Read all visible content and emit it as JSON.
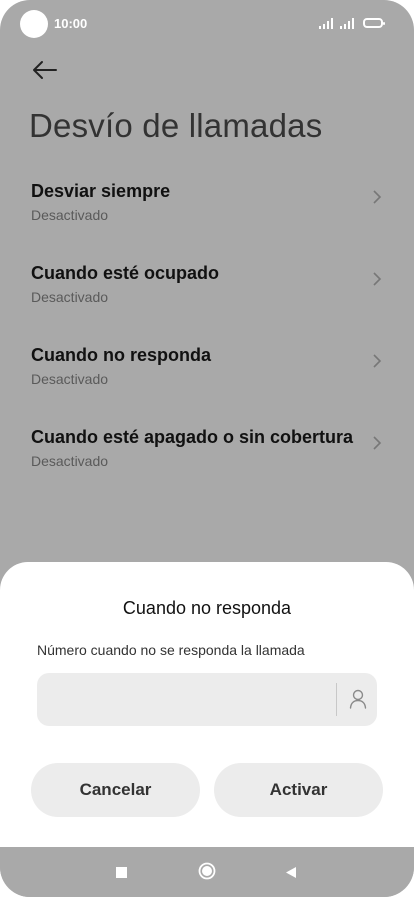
{
  "status_bar": {
    "time": "10:00"
  },
  "page": {
    "title": "Desvío de llamadas"
  },
  "menu": {
    "items": [
      {
        "label": "Desviar siempre",
        "status": "Desactivado"
      },
      {
        "label": "Cuando esté ocupado",
        "status": "Desactivado"
      },
      {
        "label": "Cuando no responda",
        "status": "Desactivado"
      },
      {
        "label": "Cuando esté apagado o sin cobertura",
        "status": "Desactivado"
      }
    ]
  },
  "dialog": {
    "title": "Cuando no responda",
    "field_label": "Número cuando no se responda la llamada",
    "field_value": "",
    "cancel_label": "Cancelar",
    "confirm_label": "Activar"
  },
  "icons": {
    "back": "arrow-left-icon",
    "chevron": "chevron-right-icon",
    "contact": "contact-person-icon",
    "nav_recents": "square-icon",
    "nav_home": "circle-home-icon",
    "nav_back": "triangle-back-icon"
  },
  "colors": {
    "scrim": "#a9a9a9",
    "sheet": "#ffffff",
    "button_bg": "#ececec",
    "text_primary": "#111111",
    "text_secondary": "#5a5a5a"
  }
}
